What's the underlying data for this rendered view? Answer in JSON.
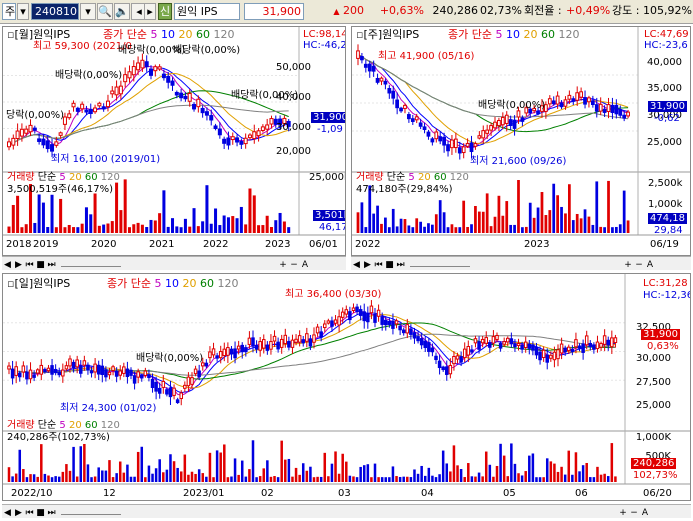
{
  "toolbar": {
    "market": "주",
    "code": "240810",
    "title": "원익 IPS",
    "badge": "신",
    "price": "31,900",
    "change": "200",
    "change_pct": "+0,63%",
    "volume": "240,286",
    "turnover": "02,73%",
    "rotation_label": "회전율 :",
    "rotation": "+0,49%",
    "strength_label": "강도 :",
    "strength": "105,92%"
  },
  "monthly": {
    "title": "[월]원익IPS",
    "ma_label": "종가 단순",
    "ma_periods": [
      "5",
      "10",
      "20",
      "60",
      "120"
    ],
    "lc": "LC:98,14",
    "hc": "HC:-46,2",
    "high_note": "최고 59,300 (2021/0",
    "low_note": "최저 16,100 (2019/01)",
    "div_notes": [
      "배당락(0,00%)",
      "배당락(0,00%)",
      "배당락(0,00%)",
      "배당락(0,00%)",
      "당락(0,00%)"
    ],
    "y_ticks": [
      "50,000",
      "40,000",
      "30,000",
      "20,000"
    ],
    "price_tag": "31,900",
    "pct_tag": "-1,09",
    "vol_label": "거래량 단순 5 20 60 120",
    "vol_value": "3,500,519주(46,17%)",
    "vol_ticks": [
      "25,000k"
    ],
    "vol_tag": "3,501k",
    "vol_pct_tag": "46,17",
    "x_ticks": [
      "2018",
      "2019",
      "2020",
      "2021",
      "2022",
      "2023",
      "06/01"
    ]
  },
  "weekly": {
    "title": "[주]원익IPS",
    "ma_label": "종가 단순",
    "ma_periods": [
      "5",
      "10",
      "20",
      "60",
      "120"
    ],
    "lc": "LC:47,69",
    "hc": "HC:-23,6",
    "high_note": "최고 41,900 (05/16)",
    "low_note": "최저 21,600 (09/26)",
    "div_note": "배당락(0,00%)",
    "y_ticks": [
      "40,000",
      "35,000",
      "30,000",
      "25,000"
    ],
    "price_tag": "31,900",
    "pct_tag": "-0,62",
    "vol_label": "거래량 단순 5 20 60 120",
    "vol_value": "474,180주(29,84%)",
    "vol_ticks": [
      "2,500k",
      "1,000k"
    ],
    "vol_tag": "474,18",
    "vol_pct_tag": "29,84",
    "x_ticks": [
      "2022",
      "2023",
      "06/19"
    ]
  },
  "daily": {
    "title": "[일]원익IPS",
    "ma_label": "종가 단순",
    "ma_periods": [
      "5",
      "10",
      "20",
      "60",
      "120"
    ],
    "lc": "LC:31,28",
    "hc": "HC:-12,36",
    "high_note": "최고 36,400 (03/30)",
    "low_note": "최저 24,300 (01/02)",
    "div_note": "배당락(0,00%)",
    "y_ticks": [
      "32,500",
      "30,000",
      "27,500",
      "25,000"
    ],
    "price_tag": "31,900",
    "pct_tag": "0,63%",
    "vol_label": "거래량 단순 5 20 60 120",
    "vol_value": "240,286주(102,73%)",
    "vol_ticks": [
      "1,000K",
      "500K"
    ],
    "vol_tag": "240,286",
    "vol_pct_tag": "102,73%",
    "x_ticks": [
      "2022/10",
      "12",
      "2023/01",
      "02",
      "03",
      "04",
      "05",
      "06",
      "06/20"
    ]
  },
  "controls": [
    "◀",
    "▶",
    "⏮",
    "■",
    "⏭",
    "+",
    "−",
    "A"
  ],
  "colors": {
    "up": "#e00000",
    "down": "#0000e0",
    "ma5": "#c000c0",
    "ma10": "#0000ff",
    "ma20": "#e0a000",
    "ma60": "#008000",
    "ma120": "#808080"
  }
}
